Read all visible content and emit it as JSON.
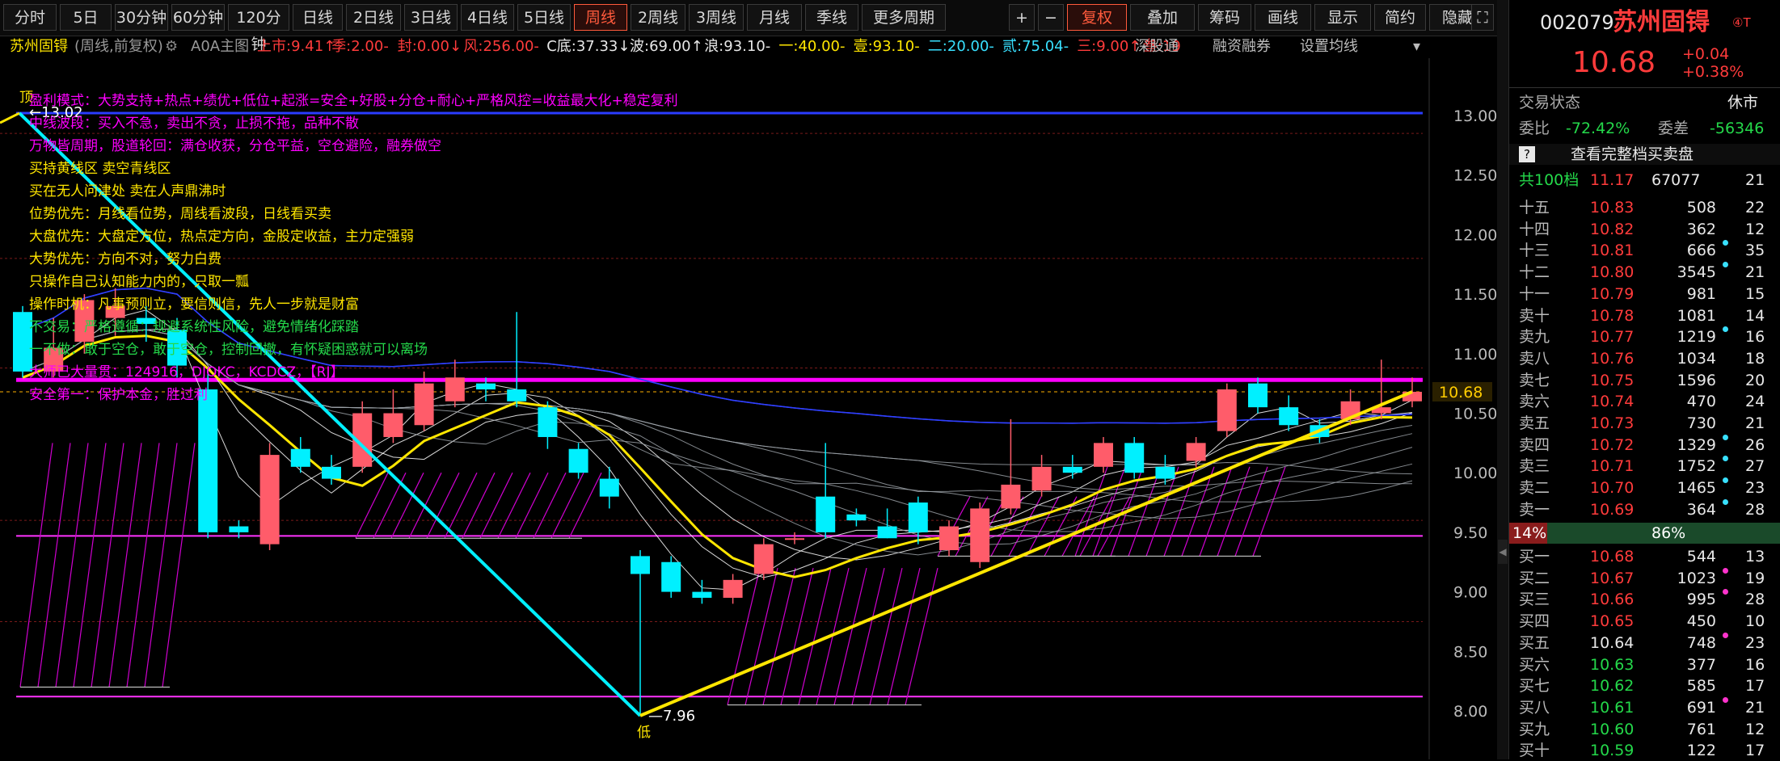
{
  "toolbar": {
    "periods": [
      "分时",
      "5日",
      "30分钟",
      "60分钟",
      "120分钟",
      "日线",
      "2日线",
      "3日线",
      "4日线",
      "5日线",
      "周线",
      "2周线",
      "3周线",
      "月线",
      "季线",
      "更多周期"
    ],
    "active_period": "周线",
    "actions": [
      "+",
      "−",
      "复权",
      "叠加",
      "筹码",
      "画线",
      "显示",
      "简约",
      "隐藏"
    ]
  },
  "infobar": {
    "name": "苏州固锝",
    "mode": "(周线,前复权)",
    "gear": "⚙",
    "main_formula": "A0A主图",
    "items": [
      {
        "text": "上市:9.41",
        "color": "#ff3b3b",
        "arrow": "↑"
      },
      {
        "text": "季:2.00",
        "color": "#ff3b3b",
        "arrow": "-"
      },
      {
        "text": "封:0.00",
        "color": "#ff3b3b",
        "arrow": "↓"
      },
      {
        "text": "风:256.00",
        "color": "#ff3b3b",
        "arrow": "-"
      },
      {
        "text": "C底:37.33",
        "color": "#e8e8e8",
        "arrow": "↓"
      },
      {
        "text": "波:69.00",
        "color": "#e8e8e8",
        "arrow": "↑"
      },
      {
        "text": "浪:93.10",
        "color": "#e8e8e8",
        "arrow": "-"
      },
      {
        "text": "一:40.00",
        "color": "#ffe600",
        "arrow": "-"
      },
      {
        "text": "壹:93.10",
        "color": "#ffe600",
        "arrow": "-"
      },
      {
        "text": "二:20.00",
        "color": "#38e0ff",
        "arrow": "-"
      },
      {
        "text": "贰:75.04",
        "color": "#38e0ff",
        "arrow": "-"
      },
      {
        "text": "三:9.00",
        "color": "#ff3b3b",
        "arrow": "↑"
      },
      {
        "text": "叁:19",
        "color": "#ff3b3b",
        "arrow": ""
      }
    ],
    "links": [
      "深股通",
      "融资融券",
      "设置均线"
    ]
  },
  "chart": {
    "high_label": "13.02",
    "low_label": "7.96",
    "top_marker": "顶",
    "bottom_marker": "低",
    "current_price_tag": "10.68",
    "y_axis": [
      "13.00",
      "12.50",
      "12.00",
      "11.50",
      "11.00",
      "10.50",
      "10.00",
      "9.50",
      "9.00",
      "8.50",
      "8.00"
    ],
    "notes": [
      {
        "text": "盈利模式：大势支持+热点+绩优+低位+起涨=安全+好股+分仓+耐心+严格风控=收益最大化+稳定复利",
        "color": "#ff00ff"
      },
      {
        "text": "中线波段：买入不急，卖出不贪，止损不拖，品种不散",
        "color": "#ff00ff"
      },
      {
        "text": "万物皆周期，股道轮回：满仓收获，分仓平益，空仓避险，融券做空",
        "color": "#ff00ff"
      },
      {
        "text": "买持黄线区   卖空青线区",
        "color": "#ffe600"
      },
      {
        "text": "买在无人问津处 卖在人声鼎沸时",
        "color": "#ffe600"
      },
      {
        "text": "位势优先：月线看位势，周线看波段，日线看买卖",
        "color": "#ffe600"
      },
      {
        "text": "大盘优先：大盘定方位，热点定方向，金股定收益，主力定强弱",
        "color": "#ffe600"
      },
      {
        "text": "大势优先：方向不对，努力白费",
        "color": "#ffe600"
      },
      {
        "text": "只操作自己认知能力内的，只取一瓢",
        "color": "#ffe600"
      },
      {
        "text": "操作时机：凡事预则立，要信则信，先人一步就是财富",
        "color": "#ffe600"
      },
      {
        "text": "不交易：严格遵循：规避系统性风险，避免情绪化踩踏",
        "color": "#24d84a"
      },
      {
        "text": "一不做：敢于空仓，敢于空仓，控制回撤，有怀疑困惑就可以离场",
        "color": "#24d84a"
      },
      {
        "text": "大师已大量贯：124916，DJOKC，KCDCZ，【RJ】",
        "color": "#ff00ff"
      },
      {
        "text": "安全第一：保护本金，胜过利",
        "color": "#ff00ff"
      }
    ]
  },
  "candles": [
    {
      "o": 11.35,
      "c": 10.85,
      "h": 11.4,
      "l": 10.8
    },
    {
      "o": 10.85,
      "c": 11.05,
      "h": 11.3,
      "l": 10.8
    },
    {
      "o": 11.1,
      "c": 11.45,
      "h": 11.5,
      "l": 11.0
    },
    {
      "o": 11.3,
      "c": 11.4,
      "h": 11.55,
      "l": 11.15
    },
    {
      "o": 11.3,
      "c": 11.25,
      "h": 11.4,
      "l": 11.1
    },
    {
      "o": 11.2,
      "c": 10.9,
      "h": 11.3,
      "l": 10.8
    },
    {
      "o": 10.7,
      "c": 9.5,
      "h": 10.85,
      "l": 9.45
    },
    {
      "o": 9.55,
      "c": 9.5,
      "h": 9.6,
      "l": 9.45
    },
    {
      "o": 9.4,
      "c": 10.15,
      "h": 10.25,
      "l": 9.35
    },
    {
      "o": 10.2,
      "c": 10.05,
      "h": 10.3,
      "l": 10.0
    },
    {
      "o": 10.05,
      "c": 9.95,
      "h": 10.15,
      "l": 9.9
    },
    {
      "o": 10.05,
      "c": 10.5,
      "h": 10.6,
      "l": 10.0
    },
    {
      "o": 10.3,
      "c": 10.5,
      "h": 10.7,
      "l": 10.25
    },
    {
      "o": 10.4,
      "c": 10.75,
      "h": 10.85,
      "l": 10.35
    },
    {
      "o": 10.6,
      "c": 10.8,
      "h": 10.95,
      "l": 10.55
    },
    {
      "o": 10.75,
      "c": 10.7,
      "h": 10.8,
      "l": 10.6
    },
    {
      "o": 10.7,
      "c": 10.6,
      "h": 11.35,
      "l": 10.55
    },
    {
      "o": 10.55,
      "c": 10.3,
      "h": 10.6,
      "l": 10.2
    },
    {
      "o": 10.2,
      "c": 10.0,
      "h": 10.25,
      "l": 9.95
    },
    {
      "o": 9.95,
      "c": 9.8,
      "h": 10.05,
      "l": 9.7
    },
    {
      "o": 9.3,
      "c": 9.15,
      "h": 9.35,
      "l": 7.96
    },
    {
      "o": 9.25,
      "c": 9.0,
      "h": 9.3,
      "l": 8.95
    },
    {
      "o": 9.0,
      "c": 8.95,
      "h": 9.1,
      "l": 8.9
    },
    {
      "o": 8.95,
      "c": 9.1,
      "h": 9.15,
      "l": 8.9
    },
    {
      "o": 9.15,
      "c": 9.4,
      "h": 9.45,
      "l": 9.1
    },
    {
      "o": 9.45,
      "c": 9.45,
      "h": 9.5,
      "l": 9.4
    },
    {
      "o": 9.8,
      "c": 9.5,
      "h": 10.25,
      "l": 9.45
    },
    {
      "o": 9.65,
      "c": 9.6,
      "h": 9.7,
      "l": 9.55
    },
    {
      "o": 9.55,
      "c": 9.45,
      "h": 9.7,
      "l": 9.45
    },
    {
      "o": 9.75,
      "c": 9.5,
      "h": 9.8,
      "l": 9.4
    },
    {
      "o": 9.35,
      "c": 9.55,
      "h": 9.6,
      "l": 9.3
    },
    {
      "o": 9.25,
      "c": 9.7,
      "h": 9.75,
      "l": 9.2
    },
    {
      "o": 9.7,
      "c": 9.9,
      "h": 10.45,
      "l": 9.65
    },
    {
      "o": 9.85,
      "c": 10.05,
      "h": 10.15,
      "l": 9.8
    },
    {
      "o": 10.05,
      "c": 10.0,
      "h": 10.15,
      "l": 9.95
    },
    {
      "o": 10.05,
      "c": 10.25,
      "h": 10.3,
      "l": 10.0
    },
    {
      "o": 10.25,
      "c": 10.0,
      "h": 10.3,
      "l": 9.95
    },
    {
      "o": 10.05,
      "c": 9.95,
      "h": 10.15,
      "l": 9.9
    },
    {
      "o": 10.1,
      "c": 10.25,
      "h": 10.3,
      "l": 10.05
    },
    {
      "o": 10.35,
      "c": 10.7,
      "h": 10.75,
      "l": 10.3
    },
    {
      "o": 10.75,
      "c": 10.55,
      "h": 10.8,
      "l": 10.5
    },
    {
      "o": 10.55,
      "c": 10.4,
      "h": 10.65,
      "l": 10.35
    },
    {
      "o": 10.4,
      "c": 10.3,
      "h": 10.45,
      "l": 10.25
    },
    {
      "o": 10.45,
      "c": 10.6,
      "h": 10.7,
      "l": 10.4
    },
    {
      "o": 10.5,
      "c": 10.55,
      "h": 10.95,
      "l": 10.45
    },
    {
      "o": 10.6,
      "c": 10.68,
      "h": 10.8,
      "l": 10.55
    }
  ],
  "side": {
    "code": "002079",
    "name": "苏州固锝",
    "badge": "④T",
    "price": "10.68",
    "change": "+0.04",
    "change_pct": "+0.38%",
    "status_label": "交易状态",
    "status_value": "休市",
    "weibi_label": "委比",
    "weibi_value": "-72.42%",
    "weicha_label": "委差",
    "weicha_value": "-56346",
    "help": "?",
    "full_book": "查看完整档买卖盘",
    "total_label": "共100档",
    "total_price": "11.17",
    "total_vol": "67077",
    "total_cnt": "21",
    "sells": [
      {
        "label": "十五",
        "price": "10.83",
        "vol": "508",
        "cnt": "22",
        "dot": ""
      },
      {
        "label": "十四",
        "price": "10.82",
        "vol": "362",
        "cnt": "12",
        "dot": ""
      },
      {
        "label": "十三",
        "price": "10.81",
        "vol": "666",
        "cnt": "35",
        "dot": "#38e0ff"
      },
      {
        "label": "十二",
        "price": "10.80",
        "vol": "3545",
        "cnt": "21",
        "dot": "#38e0ff"
      },
      {
        "label": "十一",
        "price": "10.79",
        "vol": "981",
        "cnt": "15",
        "dot": ""
      },
      {
        "label": "卖十",
        "price": "10.78",
        "vol": "1081",
        "cnt": "14",
        "dot": ""
      },
      {
        "label": "卖九",
        "price": "10.77",
        "vol": "1219",
        "cnt": "16",
        "dot": "#38e0ff"
      },
      {
        "label": "卖八",
        "price": "10.76",
        "vol": "1034",
        "cnt": "18",
        "dot": ""
      },
      {
        "label": "卖七",
        "price": "10.75",
        "vol": "1596",
        "cnt": "20",
        "dot": ""
      },
      {
        "label": "卖六",
        "price": "10.74",
        "vol": "470",
        "cnt": "24",
        "dot": ""
      },
      {
        "label": "卖五",
        "price": "10.73",
        "vol": "730",
        "cnt": "21",
        "dot": ""
      },
      {
        "label": "卖四",
        "price": "10.72",
        "vol": "1329",
        "cnt": "26",
        "dot": "#38e0ff"
      },
      {
        "label": "卖三",
        "price": "10.71",
        "vol": "1752",
        "cnt": "27",
        "dot": "#38e0ff"
      },
      {
        "label": "卖二",
        "price": "10.70",
        "vol": "1465",
        "cnt": "23",
        "dot": "#38e0ff"
      },
      {
        "label": "卖一",
        "price": "10.69",
        "vol": "364",
        "cnt": "28",
        "dot": "#38e0ff"
      }
    ],
    "ratio_left": "14%",
    "ratio_right": "86%",
    "ratio_fraction": 0.14,
    "buys": [
      {
        "label": "买一",
        "price": "10.68",
        "vol": "544",
        "cnt": "13",
        "dot": "",
        "pc": "#ff3b3b"
      },
      {
        "label": "买二",
        "price": "10.67",
        "vol": "1023",
        "cnt": "19",
        "dot": "#ff33cc",
        "pc": "#ff3b3b"
      },
      {
        "label": "买三",
        "price": "10.66",
        "vol": "995",
        "cnt": "28",
        "dot": "#ff33cc",
        "pc": "#ff3b3b"
      },
      {
        "label": "买四",
        "price": "10.65",
        "vol": "450",
        "cnt": "10",
        "dot": "",
        "pc": "#ff3b3b"
      },
      {
        "label": "买五",
        "price": "10.64",
        "vol": "748",
        "cnt": "23",
        "dot": "#ff33cc",
        "pc": "#e8e8e8"
      },
      {
        "label": "买六",
        "price": "10.63",
        "vol": "377",
        "cnt": "16",
        "dot": "",
        "pc": "#24d84a"
      },
      {
        "label": "买七",
        "price": "10.62",
        "vol": "585",
        "cnt": "17",
        "dot": "",
        "pc": "#24d84a"
      },
      {
        "label": "买八",
        "price": "10.61",
        "vol": "691",
        "cnt": "21",
        "dot": "#ff33cc",
        "pc": "#24d84a"
      },
      {
        "label": "买九",
        "price": "10.60",
        "vol": "761",
        "cnt": "12",
        "dot": "",
        "pc": "#24d84a"
      },
      {
        "label": "买十",
        "price": "10.59",
        "vol": "122",
        "cnt": "17",
        "dot": "",
        "pc": "#24d84a"
      }
    ]
  },
  "colors": {
    "up": "#ff5c6a",
    "down": "#00f0ff",
    "accent": "#ff5a3c",
    "magenta": "#ff00ff",
    "yellow": "#ffe600",
    "cyan": "#38e0ff",
    "green": "#24d84a"
  }
}
